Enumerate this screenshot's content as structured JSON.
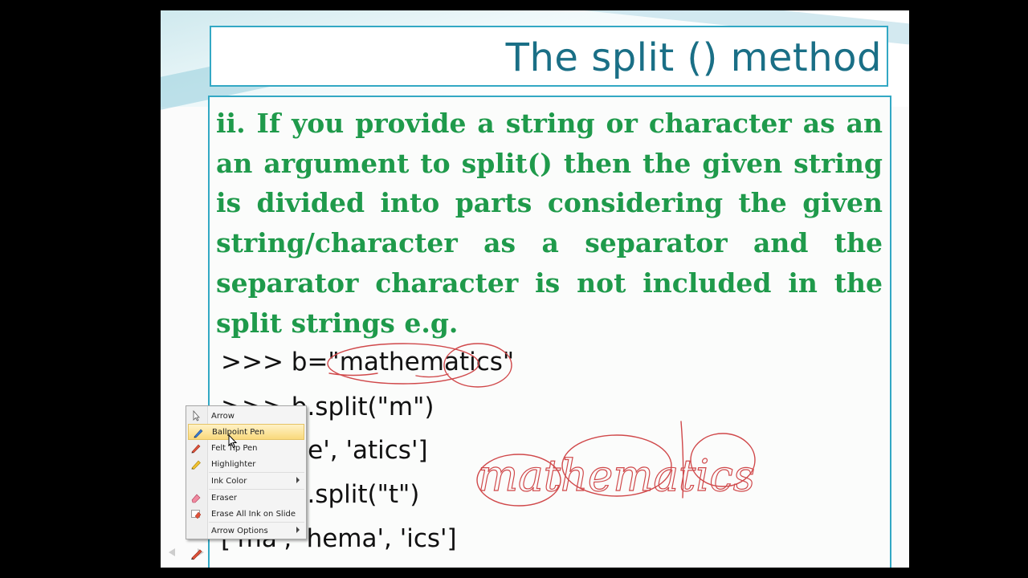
{
  "slide": {
    "title": "The split () method",
    "paragraph": "ii. If you provide a string or character as an an argument to split() then the given string is divided into parts considering the given string/character as a separator and the separator character is not included in the split strings e.g.",
    "code_lines": [
      ">>> b=\"mathematics\"",
      ">>> b.split(\"m\")",
      "['', 'athe', 'atics']",
      ">>> b.split(\"t\")",
      "['ma', 'hema', 'ics']"
    ],
    "handwriting": "mathematics"
  },
  "context_menu": {
    "items": [
      {
        "label": "Arrow",
        "icon": "arrow-pointer-icon"
      },
      {
        "label": "Ballpoint Pen",
        "icon": "ballpoint-pen-icon",
        "highlighted": true
      },
      {
        "label": "Felt Tip Pen",
        "icon": "felt-tip-pen-icon"
      },
      {
        "label": "Highlighter",
        "icon": "highlighter-icon"
      },
      {
        "label": "Ink Color",
        "icon": "",
        "submenu": true
      },
      {
        "label": "Eraser",
        "icon": "eraser-icon"
      },
      {
        "label": "Erase All Ink on Slide",
        "icon": "erase-all-ink-icon"
      },
      {
        "label": "Arrow Options",
        "icon": "",
        "submenu": true
      }
    ]
  },
  "colors": {
    "title": "#1a6f86",
    "border": "#33a8c4",
    "paragraph": "#1f9a4b",
    "ink": "#d0484a",
    "menu_highlight": "#f9d97c"
  }
}
